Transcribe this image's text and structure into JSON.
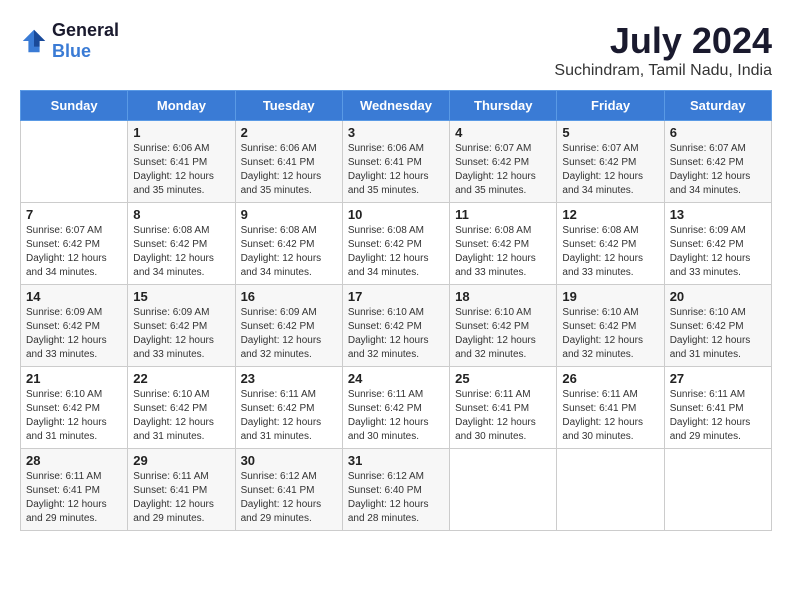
{
  "header": {
    "logo_general": "General",
    "logo_blue": "Blue",
    "month_year": "July 2024",
    "location": "Suchindram, Tamil Nadu, India"
  },
  "weekdays": [
    "Sunday",
    "Monday",
    "Tuesday",
    "Wednesday",
    "Thursday",
    "Friday",
    "Saturday"
  ],
  "weeks": [
    [
      {
        "day": "",
        "sunrise": "",
        "sunset": "",
        "daylight": ""
      },
      {
        "day": "1",
        "sunrise": "Sunrise: 6:06 AM",
        "sunset": "Sunset: 6:41 PM",
        "daylight": "Daylight: 12 hours and 35 minutes."
      },
      {
        "day": "2",
        "sunrise": "Sunrise: 6:06 AM",
        "sunset": "Sunset: 6:41 PM",
        "daylight": "Daylight: 12 hours and 35 minutes."
      },
      {
        "day": "3",
        "sunrise": "Sunrise: 6:06 AM",
        "sunset": "Sunset: 6:41 PM",
        "daylight": "Daylight: 12 hours and 35 minutes."
      },
      {
        "day": "4",
        "sunrise": "Sunrise: 6:07 AM",
        "sunset": "Sunset: 6:42 PM",
        "daylight": "Daylight: 12 hours and 35 minutes."
      },
      {
        "day": "5",
        "sunrise": "Sunrise: 6:07 AM",
        "sunset": "Sunset: 6:42 PM",
        "daylight": "Daylight: 12 hours and 34 minutes."
      },
      {
        "day": "6",
        "sunrise": "Sunrise: 6:07 AM",
        "sunset": "Sunset: 6:42 PM",
        "daylight": "Daylight: 12 hours and 34 minutes."
      }
    ],
    [
      {
        "day": "7",
        "sunrise": "Sunrise: 6:07 AM",
        "sunset": "Sunset: 6:42 PM",
        "daylight": "Daylight: 12 hours and 34 minutes."
      },
      {
        "day": "8",
        "sunrise": "Sunrise: 6:08 AM",
        "sunset": "Sunset: 6:42 PM",
        "daylight": "Daylight: 12 hours and 34 minutes."
      },
      {
        "day": "9",
        "sunrise": "Sunrise: 6:08 AM",
        "sunset": "Sunset: 6:42 PM",
        "daylight": "Daylight: 12 hours and 34 minutes."
      },
      {
        "day": "10",
        "sunrise": "Sunrise: 6:08 AM",
        "sunset": "Sunset: 6:42 PM",
        "daylight": "Daylight: 12 hours and 34 minutes."
      },
      {
        "day": "11",
        "sunrise": "Sunrise: 6:08 AM",
        "sunset": "Sunset: 6:42 PM",
        "daylight": "Daylight: 12 hours and 33 minutes."
      },
      {
        "day": "12",
        "sunrise": "Sunrise: 6:08 AM",
        "sunset": "Sunset: 6:42 PM",
        "daylight": "Daylight: 12 hours and 33 minutes."
      },
      {
        "day": "13",
        "sunrise": "Sunrise: 6:09 AM",
        "sunset": "Sunset: 6:42 PM",
        "daylight": "Daylight: 12 hours and 33 minutes."
      }
    ],
    [
      {
        "day": "14",
        "sunrise": "Sunrise: 6:09 AM",
        "sunset": "Sunset: 6:42 PM",
        "daylight": "Daylight: 12 hours and 33 minutes."
      },
      {
        "day": "15",
        "sunrise": "Sunrise: 6:09 AM",
        "sunset": "Sunset: 6:42 PM",
        "daylight": "Daylight: 12 hours and 33 minutes."
      },
      {
        "day": "16",
        "sunrise": "Sunrise: 6:09 AM",
        "sunset": "Sunset: 6:42 PM",
        "daylight": "Daylight: 12 hours and 32 minutes."
      },
      {
        "day": "17",
        "sunrise": "Sunrise: 6:10 AM",
        "sunset": "Sunset: 6:42 PM",
        "daylight": "Daylight: 12 hours and 32 minutes."
      },
      {
        "day": "18",
        "sunrise": "Sunrise: 6:10 AM",
        "sunset": "Sunset: 6:42 PM",
        "daylight": "Daylight: 12 hours and 32 minutes."
      },
      {
        "day": "19",
        "sunrise": "Sunrise: 6:10 AM",
        "sunset": "Sunset: 6:42 PM",
        "daylight": "Daylight: 12 hours and 32 minutes."
      },
      {
        "day": "20",
        "sunrise": "Sunrise: 6:10 AM",
        "sunset": "Sunset: 6:42 PM",
        "daylight": "Daylight: 12 hours and 31 minutes."
      }
    ],
    [
      {
        "day": "21",
        "sunrise": "Sunrise: 6:10 AM",
        "sunset": "Sunset: 6:42 PM",
        "daylight": "Daylight: 12 hours and 31 minutes."
      },
      {
        "day": "22",
        "sunrise": "Sunrise: 6:10 AM",
        "sunset": "Sunset: 6:42 PM",
        "daylight": "Daylight: 12 hours and 31 minutes."
      },
      {
        "day": "23",
        "sunrise": "Sunrise: 6:11 AM",
        "sunset": "Sunset: 6:42 PM",
        "daylight": "Daylight: 12 hours and 31 minutes."
      },
      {
        "day": "24",
        "sunrise": "Sunrise: 6:11 AM",
        "sunset": "Sunset: 6:42 PM",
        "daylight": "Daylight: 12 hours and 30 minutes."
      },
      {
        "day": "25",
        "sunrise": "Sunrise: 6:11 AM",
        "sunset": "Sunset: 6:41 PM",
        "daylight": "Daylight: 12 hours and 30 minutes."
      },
      {
        "day": "26",
        "sunrise": "Sunrise: 6:11 AM",
        "sunset": "Sunset: 6:41 PM",
        "daylight": "Daylight: 12 hours and 30 minutes."
      },
      {
        "day": "27",
        "sunrise": "Sunrise: 6:11 AM",
        "sunset": "Sunset: 6:41 PM",
        "daylight": "Daylight: 12 hours and 29 minutes."
      }
    ],
    [
      {
        "day": "28",
        "sunrise": "Sunrise: 6:11 AM",
        "sunset": "Sunset: 6:41 PM",
        "daylight": "Daylight: 12 hours and 29 minutes."
      },
      {
        "day": "29",
        "sunrise": "Sunrise: 6:11 AM",
        "sunset": "Sunset: 6:41 PM",
        "daylight": "Daylight: 12 hours and 29 minutes."
      },
      {
        "day": "30",
        "sunrise": "Sunrise: 6:12 AM",
        "sunset": "Sunset: 6:41 PM",
        "daylight": "Daylight: 12 hours and 29 minutes."
      },
      {
        "day": "31",
        "sunrise": "Sunrise: 6:12 AM",
        "sunset": "Sunset: 6:40 PM",
        "daylight": "Daylight: 12 hours and 28 minutes."
      },
      {
        "day": "",
        "sunrise": "",
        "sunset": "",
        "daylight": ""
      },
      {
        "day": "",
        "sunrise": "",
        "sunset": "",
        "daylight": ""
      },
      {
        "day": "",
        "sunrise": "",
        "sunset": "",
        "daylight": ""
      }
    ]
  ]
}
